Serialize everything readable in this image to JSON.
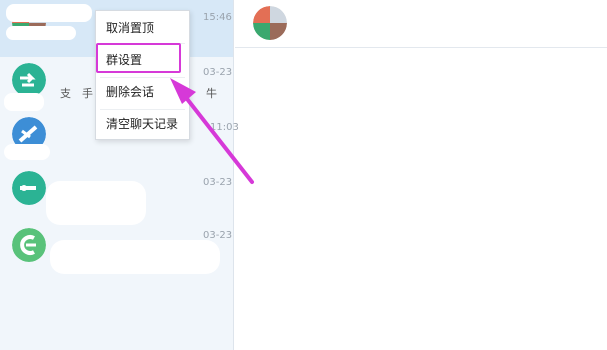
{
  "conversations": [
    {
      "time": "15:46",
      "avatar_color": "#e36f55",
      "selected": true
    },
    {
      "time": "03-23",
      "avatar_color": "#2bb394",
      "preview": "支",
      "preview_b": "手",
      "preview_c": "牛"
    },
    {
      "time": "11:03",
      "avatar_color": "#3d8ed6"
    },
    {
      "time": "03-23",
      "avatar_color": "#2bb394"
    },
    {
      "time": "03-23",
      "avatar_color": "#59c27a"
    }
  ],
  "context_menu": {
    "items": [
      "取消置顶",
      "群设置",
      "删除会话",
      "清空聊天记录"
    ],
    "highlighted": "群设置",
    "highlight_color": "#d639d8"
  },
  "colors": {
    "list_bg": "#f1f6fb",
    "selected_bg": "#d7e8f7",
    "arrow": "#d639d8"
  }
}
